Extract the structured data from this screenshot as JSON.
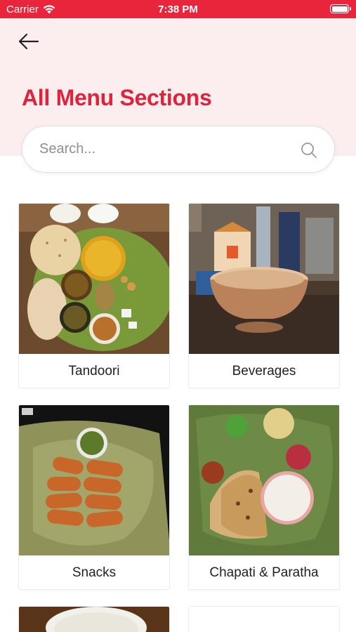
{
  "status_bar": {
    "carrier": "Carrier",
    "time": "7:38 PM"
  },
  "header": {
    "title": "All Menu Sections"
  },
  "search": {
    "placeholder": "Search..."
  },
  "sections": [
    {
      "label": "Tandoori"
    },
    {
      "label": "Beverages"
    },
    {
      "label": "Snacks"
    },
    {
      "label": "Chapati & Paratha"
    }
  ],
  "colors": {
    "accent": "#e0233a",
    "status_bar": "#e8253a",
    "header_bg": "#fcedef"
  },
  "icons": {
    "back": "arrow-left-icon",
    "search": "search-icon",
    "wifi": "wifi-icon",
    "battery": "battery-icon"
  }
}
